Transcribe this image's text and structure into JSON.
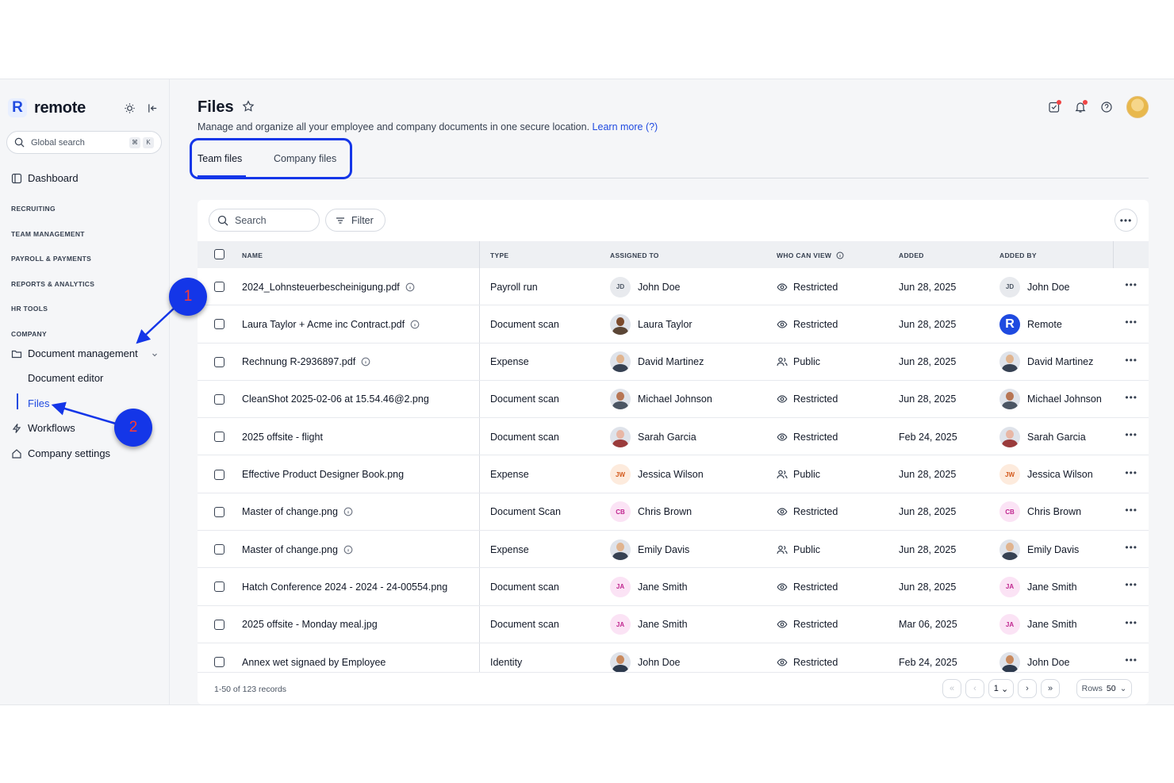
{
  "brand": {
    "name": "remote",
    "logo_letter": "R"
  },
  "sidebar": {
    "search_placeholder": "Global search",
    "shortcut_keys": [
      "⌘",
      "K"
    ],
    "dashboard": "Dashboard",
    "sections": [
      "RECRUITING",
      "TEAM MANAGEMENT",
      "PAYROLL & PAYMENTS",
      "REPORTS & ANALYTICS",
      "HR TOOLS",
      "COMPANY"
    ],
    "document_management": "Document management",
    "sub_items": [
      "Document editor",
      "Files"
    ],
    "workflows": "Workflows",
    "company_settings": "Company settings"
  },
  "page": {
    "title": "Files",
    "subtitle": "Manage and organize all your employee and company documents in one secure location.",
    "learn_more": "Learn more (?)"
  },
  "tabs": [
    "Team files",
    "Company files"
  ],
  "toolbar": {
    "search_placeholder": "Search",
    "filter_label": "Filter"
  },
  "table": {
    "headers": [
      "NAME",
      "TYPE",
      "ASSIGNED TO",
      "WHO CAN VIEW",
      "ADDED",
      "ADDED BY"
    ],
    "rows": [
      {
        "name": "2024_Lohnsteuerbescheinigung.pdf",
        "info": true,
        "type": "Payroll run",
        "assigned": "John Doe",
        "assigned_avatar": "JD",
        "view": "Restricted",
        "added": "Jun 28, 2025",
        "by": "John Doe"
      },
      {
        "name": "Laura Taylor + Acme inc Contract.pdf",
        "info": true,
        "type": "Document scan",
        "assigned": "Laura Taylor",
        "assigned_avatar": "",
        "view": "Restricted",
        "added": "Jun 28, 2025",
        "by": "Remote"
      },
      {
        "name": "Rechnung R-2936897.pdf",
        "info": true,
        "type": "Expense",
        "assigned": "David Martinez",
        "assigned_avatar": "",
        "view": "Public",
        "added": "Jun 28, 2025",
        "by": "David Martinez"
      },
      {
        "name": "CleanShot 2025-02-06 at 15.54.46@2.png",
        "info": false,
        "type": "Document scan",
        "assigned": "Michael Johnson",
        "assigned_avatar": "",
        "view": "Restricted",
        "added": "Jun 28, 2025",
        "by": "Michael Johnson"
      },
      {
        "name": "2025 offsite - flight",
        "info": false,
        "type": "Document scan",
        "assigned": "Sarah Garcia",
        "assigned_avatar": "",
        "view": "Restricted",
        "added": "Feb 24, 2025",
        "by": "Sarah Garcia"
      },
      {
        "name": "Effective Product Designer Book.png",
        "info": false,
        "type": "Expense",
        "assigned": "Jessica Wilson",
        "assigned_avatar": "JW",
        "view": "Public",
        "added": "Jun 28, 2025",
        "by": "Jessica Wilson"
      },
      {
        "name": "Master of change.png",
        "info": true,
        "type": "Document Scan",
        "assigned": "Chris Brown",
        "assigned_avatar": "CB",
        "view": "Restricted",
        "added": "Jun 28, 2025",
        "by": "Chris Brown"
      },
      {
        "name": "Master of change.png",
        "info": true,
        "type": "Expense",
        "assigned": "Emily Davis",
        "assigned_avatar": "",
        "view": "Public",
        "added": "Jun 28, 2025",
        "by": "Emily Davis"
      },
      {
        "name": "Hatch Conference 2024 - 2024 - 24-00554.png",
        "info": false,
        "type": "Document scan",
        "assigned": "Jane Smith",
        "assigned_avatar": "JA",
        "view": "Restricted",
        "added": "Jun 28, 2025",
        "by": "Jane Smith"
      },
      {
        "name": "2025 offsite - Monday meal.jpg",
        "info": false,
        "type": "Document scan",
        "assigned": "Jane Smith",
        "assigned_avatar": "JA",
        "view": "Restricted",
        "added": "Mar 06, 2025",
        "by": "Jane Smith"
      },
      {
        "name": "Annex wet signaed by Employee",
        "info": false,
        "type": "Identity",
        "assigned": "John Doe",
        "assigned_avatar": "",
        "view": "Restricted",
        "added": "Feb 24, 2025",
        "by": "John Doe"
      }
    ]
  },
  "footer": {
    "records": "1-50 of 123 records",
    "page": "1",
    "rows_label": "Rows",
    "rows_value": "50"
  },
  "annotations": [
    "1",
    "2"
  ],
  "colors": {
    "accent": "#1f4ae0",
    "annotation": "#1436e8",
    "annotation_text": "#ff3b30"
  }
}
